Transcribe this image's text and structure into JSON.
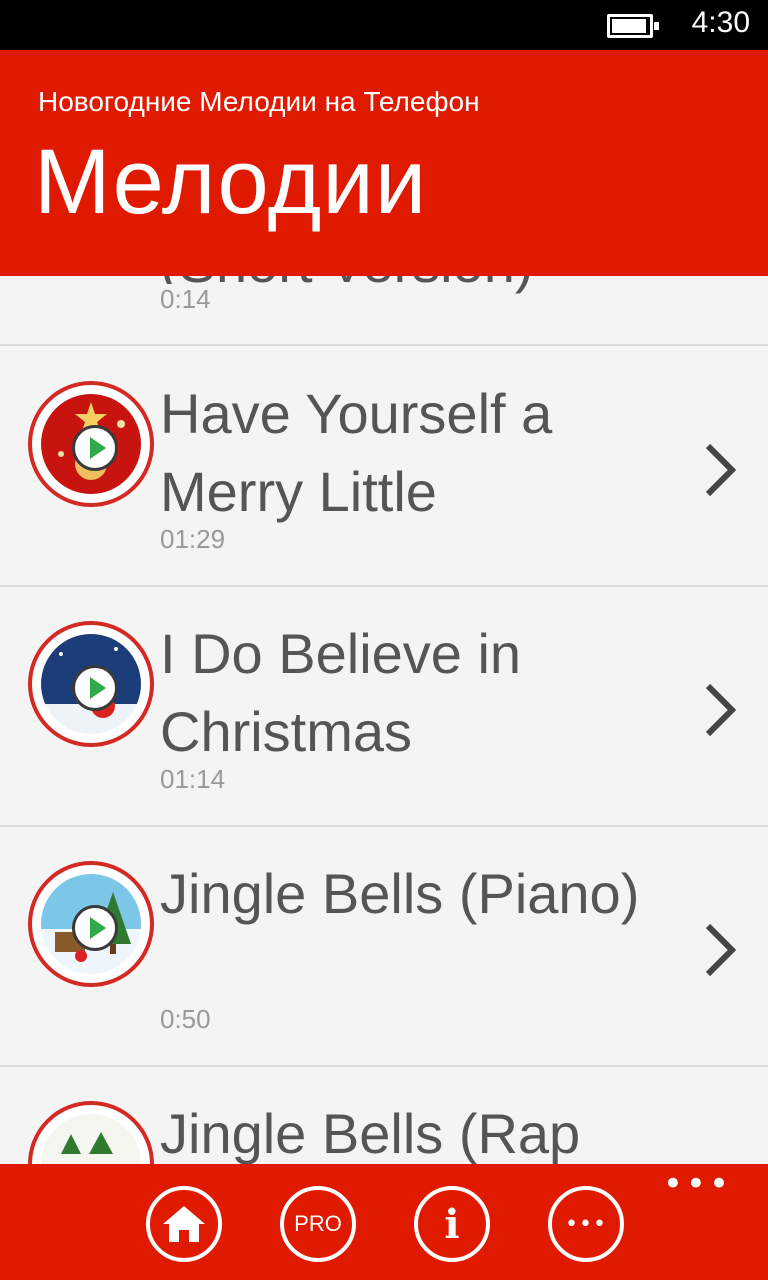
{
  "status": {
    "time": "4:30",
    "battery_level": 0.85
  },
  "header": {
    "app_title": "Новогодние Мелодии на Телефон",
    "page_title": "Мелодии"
  },
  "list": {
    "items": [
      {
        "title": "(Short Version)",
        "duration": "0:14"
      },
      {
        "title": "Have Yourself a Merry Little Christmas",
        "duration": "01:29",
        "thumbnail": "red-ornament-thumbnail"
      },
      {
        "title": "I Do Believe in Christmas",
        "duration": "01:14",
        "thumbnail": "santa-night-thumbnail"
      },
      {
        "title": "Jingle Bells (Piano)",
        "duration": "0:50",
        "thumbnail": "snowy-tree-thumbnail"
      },
      {
        "title": "Jingle Bells (Rap",
        "duration": "",
        "thumbnail": "holly-thumbnail"
      }
    ]
  },
  "appbar": {
    "pro_label": "PRO",
    "info_label": "i",
    "more_label": "•••",
    "overflow": "•••"
  },
  "colors": {
    "accent": "#e01a00",
    "list_bg": "#f4f4f4",
    "text": "#555555",
    "muted": "#999999"
  }
}
